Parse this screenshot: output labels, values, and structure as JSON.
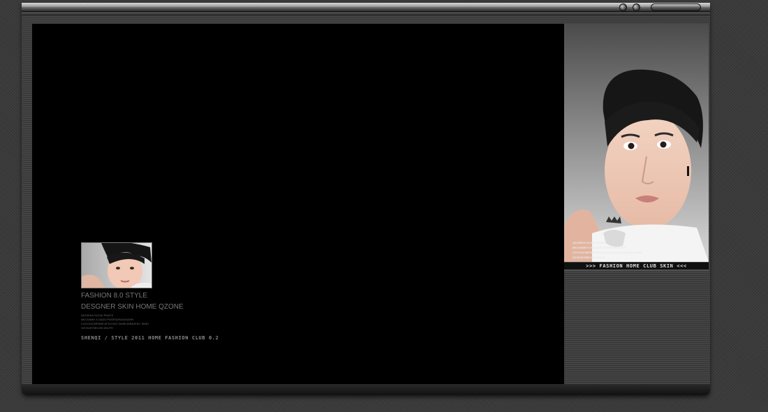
{
  "showcase": {
    "line1": "FASHION 8.0 STYLE",
    "line2": "DESGNER SKIN HOME QZONE",
    "small_lines": [
      "ASJDEKA  SLDJK PNJIFZ",
      "MKCN3MH  S SADO PDSFSDFAXDNJHR",
      "CXZVUXCBPNHEJIFXCHIJC  DASKJDBAJKSC  SIIND",
      "XZCNJKTMICJIN DKLPH"
    ],
    "footer": "SHENQI / STYLE 2011 HOME FASHION CLUB 0.2"
  },
  "side": {
    "small_lines": [
      "ASJDEKA  SLDJK PNJIFZ",
      "MKCN3MH  S SADO PDSFSDFAXDNJHR",
      "CXZVUXCBPNHEJIFXCHIJC  DASKJDBAJKSC  SIIND",
      "XZCNJKTMICJIN DKLPH"
    ],
    "banner": ">>> FASHION HOME CLUB SKIN <<<"
  },
  "colors": {
    "main_bg": "#000000",
    "frame": "#444444"
  },
  "icons": [
    "portrait-photo",
    "window-dot",
    "window-pill"
  ]
}
